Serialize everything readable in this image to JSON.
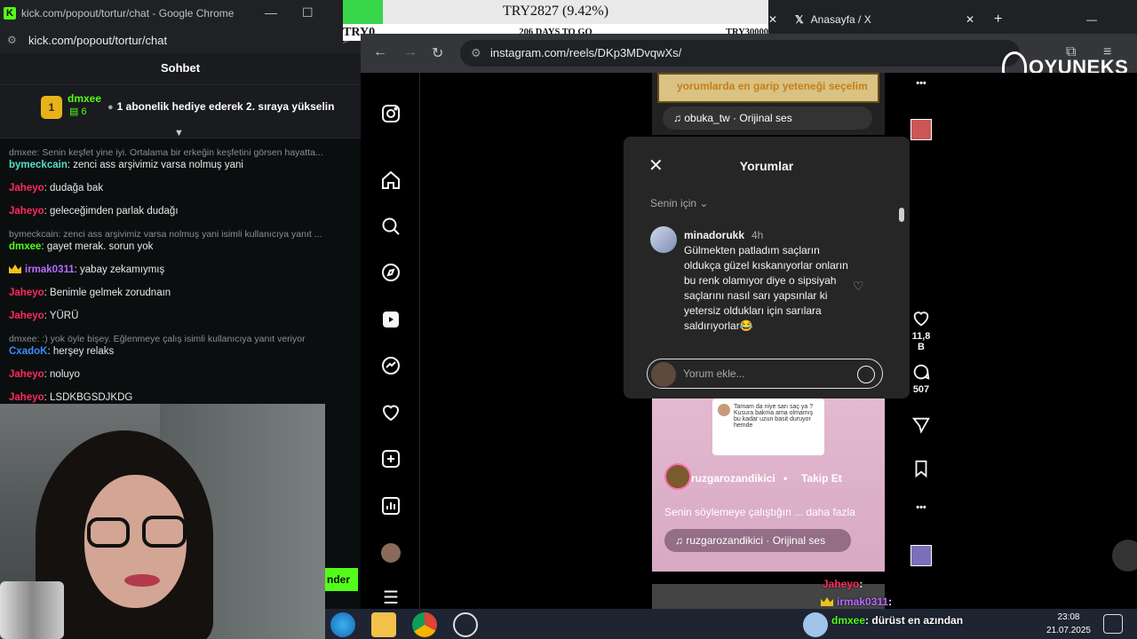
{
  "kick": {
    "window_title": "kick.com/popout/tortur/chat - Google Chrome",
    "url": "kick.com/popout/tortur/chat",
    "chat_title": "Sohbet",
    "pinned": {
      "badge": "1",
      "user": "dmxee",
      "count": "6",
      "message": "1 abonelik hediye ederek 2. sıraya yükselin"
    },
    "messages": [
      {
        "reply": "dmxee: Senin keşfet yine iyi. Ortalama bir erkeğin keşfetini görsen hayatta..."
      },
      {
        "user": "bymeckcain",
        "color": "#53e0c8",
        "text": ": zenci ass arşivimiz varsa nolmuş yani"
      },
      {
        "user": "Jaheyo",
        "color": "#ff2a5c",
        "text": ": dudağa bak"
      },
      {
        "user": "Jaheyo",
        "color": "#ff2a5c",
        "text": ": geleceğimden parlak dudağı"
      },
      {
        "reply": "bymeckcain: zenci ass arşivimiz varsa nolmuş yani isimli kullanıcıya yanıt ..."
      },
      {
        "user": "dmxee",
        "color": "#53fc18",
        "text": ": gayet merak. sorun yok"
      },
      {
        "user": "irmak0311",
        "color": "#b66bff",
        "text": ": yabay zekamıymış",
        "crown": true
      },
      {
        "user": "Jaheyo",
        "color": "#ff2a5c",
        "text": ": Benimle gelmek zorudnaın"
      },
      {
        "user": "Jaheyo",
        "color": "#ff2a5c",
        "text": ": YÜRÜ"
      },
      {
        "reply": "dmxee: :) yok öyle bişey. Eğlenmeye çalış isimli kullanıcıya yanıt veriyor"
      },
      {
        "user": "CxadoK",
        "color": "#3d8bff",
        "text": ": herşey relaks"
      },
      {
        "user": "Jaheyo",
        "color": "#ff2a5c",
        "text": ": noluyo"
      },
      {
        "user": "Jaheyo",
        "color": "#ff2a5c",
        "text": ": LSDKBGSDJKDG"
      }
    ],
    "send_label": "nder"
  },
  "goal": {
    "amount": "TRY2827 (9.42%)",
    "progress_pct": 9.42,
    "left_label": "TRY0",
    "days": "206 DAYS TO GO",
    "right_label": "TRY30000"
  },
  "browser": {
    "tab_title": "Anasayfa / X",
    "url": "instagram.com/reels/DKp3MDvqwXs/"
  },
  "brand": {
    "name": "OYUNEKS"
  },
  "reel_top": {
    "overlay_text": "yorumlarda en garip yeteneği seçelim",
    "audio": "obuka_tw · Orijinal ses"
  },
  "comments": {
    "title": "Yorumlar",
    "filter": "Senin için",
    "items": [
      {
        "user": "minadorukk",
        "time": "4h",
        "text": "Gülmekten patladım saçların oldukça güzel kıskanıyorlar onların bu renk olamıyor diye o sipsiyah saçlarını nasıl sarı yapsınlar ki yetersiz oldukları için sarılara saldırıyorlar😂"
      }
    ],
    "input_placeholder": "Yorum ekle..."
  },
  "reel": {
    "note": "Tamam da niye sarı saç ya ? Kusura bakma ama olmamış bu kadar uzun basit duruyor hemde",
    "author": "ruzgarozandikici",
    "follow": "Takip Et",
    "caption": "Senin söylemeye çalıştığın ... daha fazla",
    "audio": "ruzgarozandikici · Orijinal ses"
  },
  "actions": {
    "likes": "11,8 B",
    "comments": "507"
  },
  "overlay_chat": [
    {
      "user": "Jaheyo",
      "color": "#ff2a5c",
      "text": ":"
    },
    {
      "user": "irmak0311",
      "color": "#b66bff",
      "text": ":"
    },
    {
      "user": "dmxee",
      "color": "#53fc18",
      "text": ": dürüst en azından"
    }
  ],
  "clock": {
    "time": "23:08",
    "date": "21.07.2025"
  },
  "colors": {
    "kick_green": "#53fc18",
    "ig_bg": "#000000",
    "progress": "#37d64b"
  }
}
